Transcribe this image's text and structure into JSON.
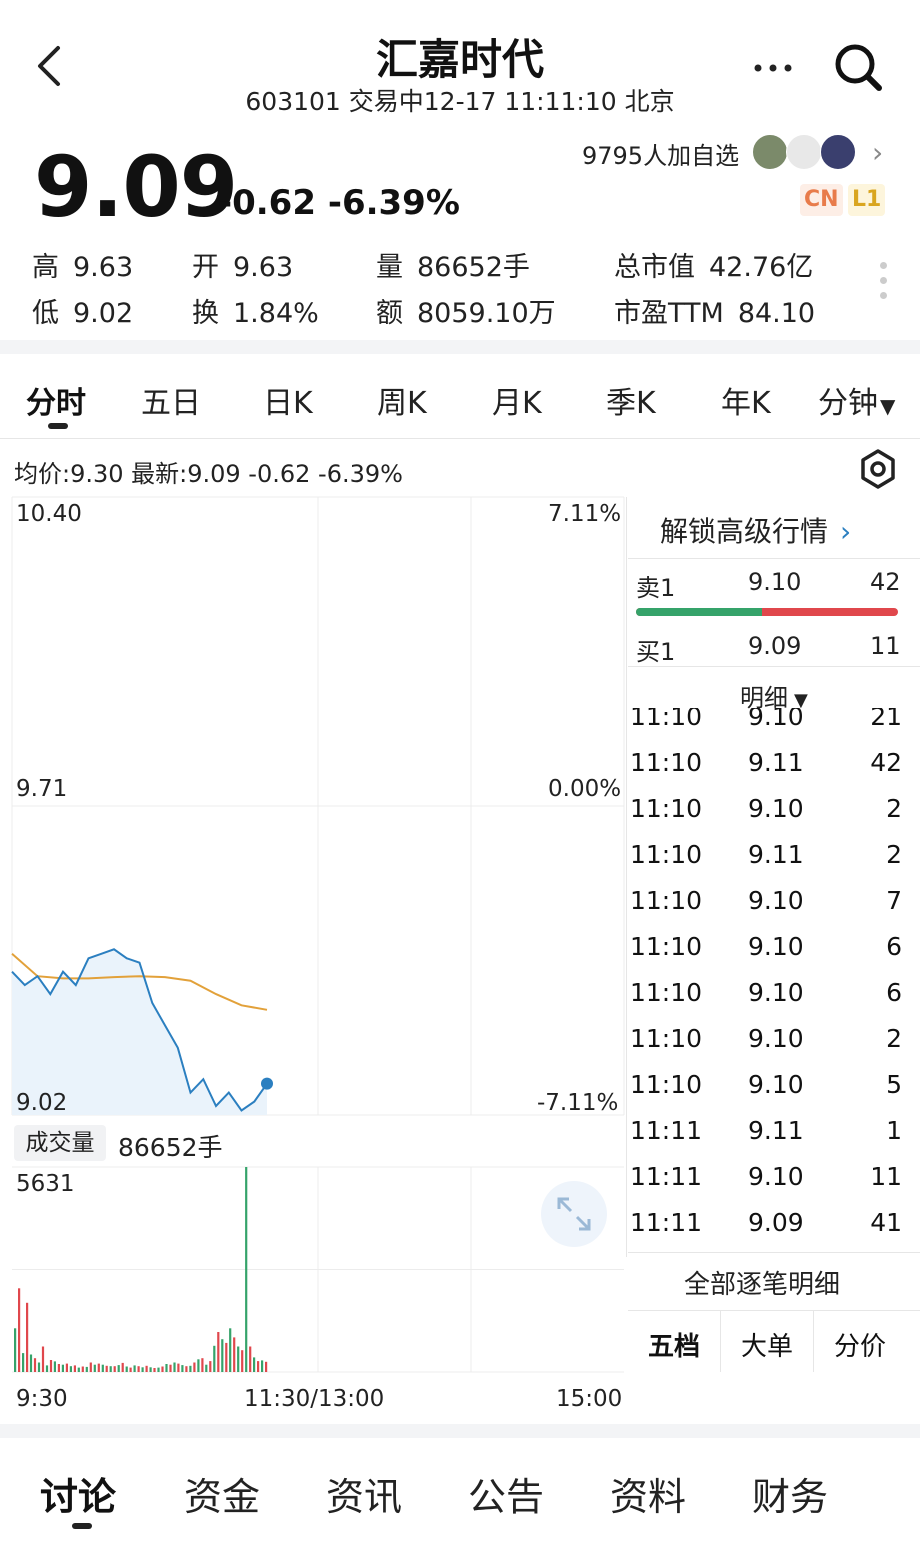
{
  "header": {
    "title": "汇嘉时代",
    "subtitle": "603101 交易中12-17 11:11:10 北京",
    "more_icon": "more-dots-icon",
    "search_icon": "search-icon"
  },
  "quote": {
    "price": "9.09",
    "change": "-0.62 -6.39%",
    "followers": "9795人加自选",
    "badge_cn": "CN",
    "badge_l1": "L1",
    "stats": {
      "high_k": "高",
      "high_v": "9.63",
      "open_k": "开",
      "open_v": "9.63",
      "volume_k": "量",
      "volume_v": "86652手",
      "mktcap_k": "总市值",
      "mktcap_v": "42.76亿",
      "low_k": "低",
      "low_v": "9.02",
      "turnover_k": "换",
      "turnover_v": "1.84%",
      "amount_k": "额",
      "amount_v": "8059.10万",
      "pe_k": "市盈TTM",
      "pe_v": "84.10"
    }
  },
  "tabs": [
    "分时",
    "五日",
    "日K",
    "周K",
    "月K",
    "季K",
    "年K",
    "分钟"
  ],
  "chart_info": "均价:9.30  最新:9.09  -0.62  -6.39%",
  "chart_data": {
    "type": "line",
    "series": [
      {
        "name": "",
        "role": "price",
        "color": "#2b7fc0",
        "x": [
          "09:30",
          "09:35",
          "09:40",
          "09:45",
          "09:50",
          "09:55",
          "10:00",
          "10:05",
          "10:10",
          "10:15",
          "10:20",
          "10:25",
          "10:30",
          "10:35",
          "10:40",
          "10:45",
          "10:50",
          "10:55",
          "11:00",
          "11:05",
          "11:10"
        ],
        "values": [
          9.34,
          9.31,
          9.33,
          9.29,
          9.34,
          9.31,
          9.37,
          9.38,
          9.39,
          9.37,
          9.36,
          9.27,
          9.22,
          9.17,
          9.07,
          9.1,
          9.04,
          9.07,
          9.03,
          9.05,
          9.09
        ]
      },
      {
        "name": "",
        "role": "avg",
        "color": "#e2a13a",
        "x": [
          "09:30",
          "09:40",
          "09:50",
          "10:00",
          "10:10",
          "10:20",
          "10:30",
          "10:40",
          "10:50",
          "11:00",
          "11:10"
        ],
        "values": [
          9.38,
          9.33,
          9.325,
          9.325,
          9.328,
          9.33,
          9.328,
          9.32,
          9.29,
          9.265,
          9.255
        ]
      }
    ],
    "y_left": {
      "top": "10.40",
      "mid": "9.71",
      "bottom": "9.02"
    },
    "y_right": {
      "top": "7.11%",
      "mid": "0.00%",
      "bottom": "-7.11%"
    },
    "x_labels": [
      "9:30",
      "11:30/13:00",
      "15:00"
    ],
    "volume": {
      "label": "成交量",
      "total": "86652手",
      "max_label": "5631",
      "bars": [
        1200,
        2300,
        520,
        1900,
        480,
        380,
        260,
        700,
        180,
        330,
        290,
        220,
        200,
        230,
        160,
        180,
        120,
        150,
        140,
        260,
        200,
        230,
        200,
        170,
        160,
        160,
        190,
        250,
        150,
        120,
        180,
        160,
        130,
        170,
        130,
        110,
        120,
        150,
        220,
        200,
        260,
        230,
        190,
        160,
        170,
        260,
        350,
        380,
        200,
        300,
        720,
        1100,
        900,
        800,
        1200,
        950,
        700,
        600,
        5631,
        700,
        400,
        300,
        320,
        280
      ],
      "colors": [
        "g",
        "r",
        "g",
        "r",
        "g",
        "r",
        "g",
        "r",
        "g",
        "r",
        "g",
        "r",
        "g",
        "r",
        "g",
        "r",
        "g",
        "r",
        "g",
        "r",
        "g",
        "r",
        "g",
        "r",
        "g",
        "r",
        "g",
        "r",
        "g",
        "r",
        "g",
        "r",
        "g",
        "r",
        "g",
        "r",
        "g",
        "r",
        "g",
        "r",
        "g",
        "r",
        "g",
        "r",
        "g",
        "r",
        "g",
        "r",
        "g",
        "r",
        "g",
        "r",
        "g",
        "r",
        "g",
        "r",
        "g",
        "r",
        "g",
        "r",
        "g",
        "r",
        "g",
        "r"
      ]
    }
  },
  "orderbook": {
    "unlock": "解锁高级行情",
    "sell_label": "卖1",
    "sell_price": "9.10",
    "sell_qty": "42",
    "buy_label": "买1",
    "buy_price": "9.09",
    "buy_qty": "11",
    "detail_label": "明细",
    "ticks": [
      {
        "t": "11:10",
        "p": "9.10",
        "q": "21"
      },
      {
        "t": "11:10",
        "p": "9.11",
        "q": "42"
      },
      {
        "t": "11:10",
        "p": "9.10",
        "q": "2"
      },
      {
        "t": "11:10",
        "p": "9.11",
        "q": "2"
      },
      {
        "t": "11:10",
        "p": "9.10",
        "q": "7"
      },
      {
        "t": "11:10",
        "p": "9.10",
        "q": "6"
      },
      {
        "t": "11:10",
        "p": "9.10",
        "q": "6"
      },
      {
        "t": "11:10",
        "p": "9.10",
        "q": "2"
      },
      {
        "t": "11:10",
        "p": "9.10",
        "q": "5"
      },
      {
        "t": "11:11",
        "p": "9.11",
        "q": "1"
      },
      {
        "t": "11:11",
        "p": "9.10",
        "q": "11"
      },
      {
        "t": "11:11",
        "p": "9.09",
        "q": "41"
      }
    ],
    "all_details": "全部逐笔明细",
    "bottom_tabs": [
      "五档",
      "大单",
      "分价"
    ]
  },
  "bottom_nav": [
    "讨论",
    "资金",
    "资讯",
    "公告",
    "资料",
    "财务"
  ],
  "colors": {
    "up": "#e0474c",
    "down": "#35a36a",
    "price_line": "#2b7fc0",
    "avg_line": "#e2a13a"
  }
}
